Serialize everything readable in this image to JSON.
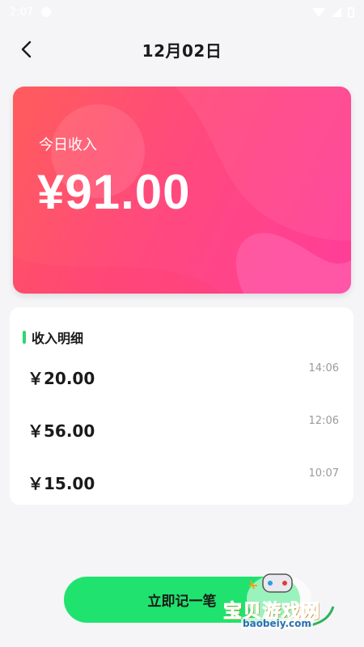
{
  "status_bar": {
    "time": "2:07"
  },
  "header": {
    "title": "12月02日"
  },
  "card": {
    "label": "今日收入",
    "amount": "¥91.00"
  },
  "details": {
    "title": "收入明细",
    "records": [
      {
        "amount": "￥20.00",
        "time": "14:06"
      },
      {
        "amount": "￥56.00",
        "time": "12:06"
      },
      {
        "amount": "￥15.00",
        "time": "10:07"
      }
    ]
  },
  "add_button": {
    "label": "立即记一笔"
  },
  "watermark": {
    "name": "宝贝游戏网",
    "url": "baobeiy.com"
  },
  "colors": {
    "card_gradient_start": "#ff5c5c",
    "card_gradient_end": "#ff3d9a",
    "accent_green": "#1fe36e",
    "background": "#f5f5f7"
  }
}
